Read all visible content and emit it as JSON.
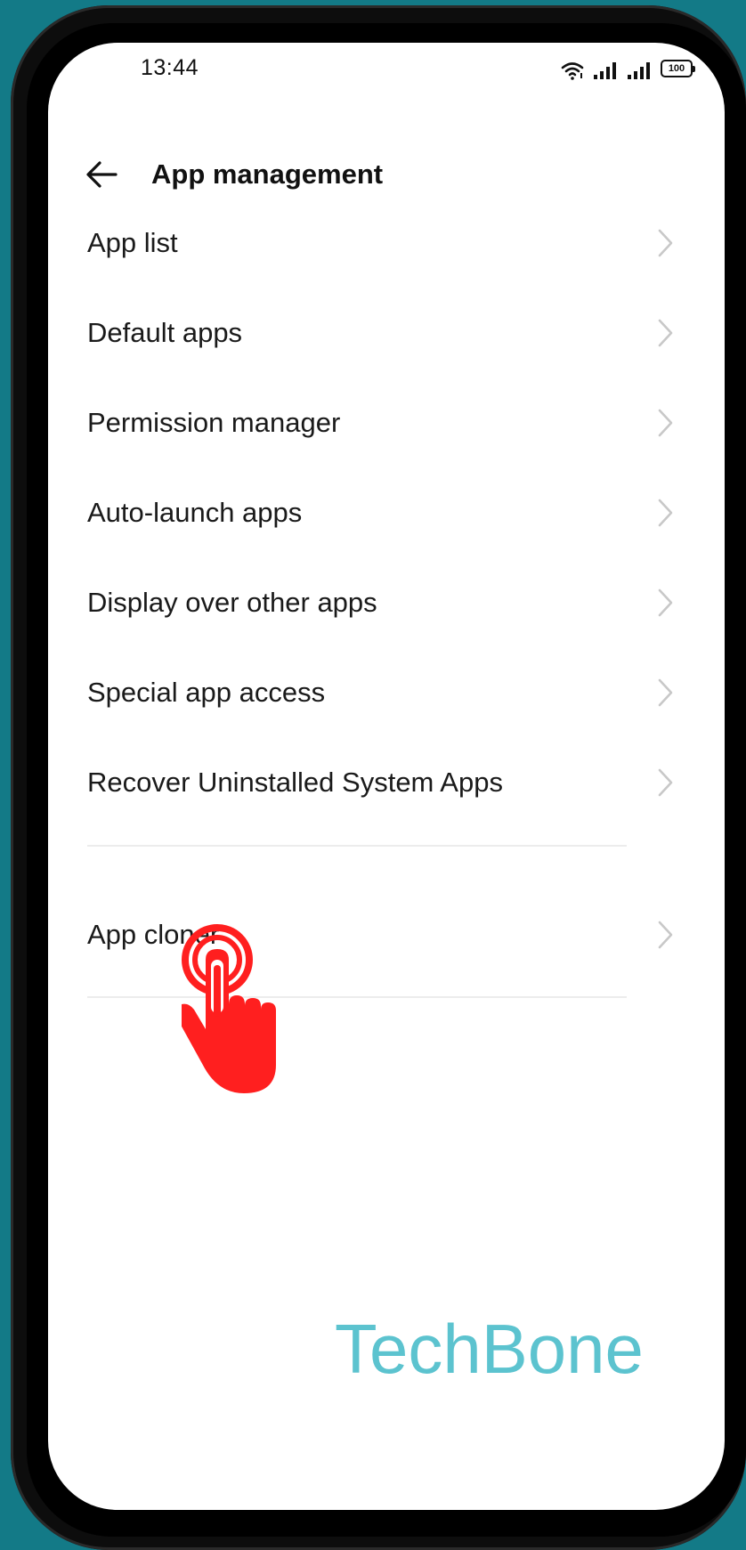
{
  "status_bar": {
    "time": "13:44",
    "battery": "100",
    "icons": [
      "wifi-icon",
      "signal-icon",
      "signal-icon",
      "battery-icon"
    ]
  },
  "header": {
    "back_icon": "back-arrow-icon",
    "title": "App management"
  },
  "menu": {
    "items": [
      {
        "label": "App list"
      },
      {
        "label": "Default apps"
      },
      {
        "label": "Permission manager"
      },
      {
        "label": "Auto-launch apps"
      },
      {
        "label": "Display over other apps"
      },
      {
        "label": "Special app access"
      },
      {
        "label": "Recover Uninstalled System Apps"
      },
      {
        "label": "App cloner"
      }
    ]
  },
  "overlay": {
    "tap_icon": "tap-hand-icon",
    "color": "#ff1f1f"
  },
  "watermark": "TechBone",
  "colors": {
    "background": "#137a87",
    "watermark": "#5cc3cf",
    "tap": "#ff1f1f"
  }
}
